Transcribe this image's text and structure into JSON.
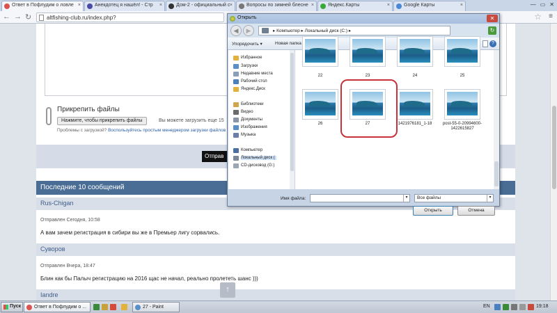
{
  "browser": {
    "tabs": [
      {
        "label": "Ответ в Пофлудим о ловле",
        "color": "#d9534f",
        "active": true
      },
      {
        "label": "Анекдотец я нашёл! - Стр",
        "color": "#4a4aa8",
        "active": false
      },
      {
        "label": "Дом-2 - официальный с",
        "color": "#333333",
        "active": false
      },
      {
        "label": "Вопросы по зимней блесне",
        "color": "#777777",
        "active": false
      },
      {
        "label": "Яндекс.Карты",
        "color": "#3aa93a",
        "active": false
      },
      {
        "label": "Google Карты",
        "color": "#4a88d8",
        "active": false
      }
    ],
    "url": "altfishing-club.ru/index.php?"
  },
  "forum": {
    "attach_title": "Прикрепить файлы",
    "attach_button": "Нажмите, чтобы прикрепить файлы",
    "attach_hint": "Вы можете загрузить еще 15",
    "problems_text": "Проблемы с загрузкой?",
    "problems_link": "Воспользуйтесь простым менеджером загрузки файлов",
    "send_button": "Отправ",
    "recent_header": "Последние 10 сообщений",
    "posts": [
      {
        "user": "Rus-Chigan",
        "meta": "Отправлен Сегодня, 10:58",
        "text": "А вам зачем регистрация в сибири вы же в Премьер лигу сорвались."
      },
      {
        "user": "Суворов",
        "meta": "Отправлен Вчера, 18:47",
        "text": "Блин как бы Палыч регистрацию на 2016 щас не начал, реально пролететь шанс )))"
      },
      {
        "user": "Iandre",
        "meta": "",
        "text": ""
      }
    ],
    "to_top": "↑"
  },
  "dialog": {
    "title": "Открыть",
    "breadcrumb": "▸ Компьютер ▸ Локальный диск (C:) ▸",
    "organize": "Упорядочить ▾",
    "new_folder": "Новая папка",
    "nav": [
      {
        "label": "Избранное",
        "icon": "star-icon",
        "color": "#e3b23c"
      },
      {
        "label": "Загрузки",
        "icon": "downloads-icon",
        "color": "#5a8fc8"
      },
      {
        "label": "Недавние места",
        "icon": "recent-icon",
        "color": "#8aa0b8"
      },
      {
        "label": "Рабочий стол",
        "icon": "desktop-icon",
        "color": "#4a7fc0"
      },
      {
        "label": "Яндекс.Диск",
        "icon": "yadisk-icon",
        "color": "#e3b23c"
      },
      {
        "label": "Библиотеки",
        "icon": "library-icon",
        "color": "#d1a54a"
      },
      {
        "label": "Видео",
        "icon": "video-icon",
        "color": "#6b6b6b"
      },
      {
        "label": "Документы",
        "icon": "documents-icon",
        "color": "#8a96a6"
      },
      {
        "label": "Изображения",
        "icon": "images-icon",
        "color": "#5a8fc8"
      },
      {
        "label": "Музыка",
        "icon": "music-icon",
        "color": "#6b7fa8"
      },
      {
        "label": "Компьютер",
        "icon": "computer-icon",
        "color": "#4a6fa0"
      },
      {
        "label": "Локальный диск (",
        "icon": "disk-icon",
        "color": "#7a8898"
      },
      {
        "label": "CD-дисковод (G:)",
        "icon": "cd-icon",
        "color": "#9aa6b4"
      }
    ],
    "files": [
      "22",
      "23",
      "24",
      "25",
      "26",
      "27",
      "1421976181_1-18",
      "post-55-0-20994600-1422615827"
    ],
    "filename_label": "Имя файла:",
    "filename_value": "",
    "filetype": "Все файлы",
    "open_button": "Открыть",
    "cancel_button": "Отмена",
    "close_glyph": "✕"
  },
  "taskbar": {
    "start": "Пуск",
    "tasks": [
      {
        "label": "Ответ в Пофлудим о ...",
        "color": "#d9534f"
      },
      {
        "label": "27 - Paint",
        "color": "#5a8fc8"
      }
    ],
    "lang": "EN",
    "time": "19:18"
  }
}
